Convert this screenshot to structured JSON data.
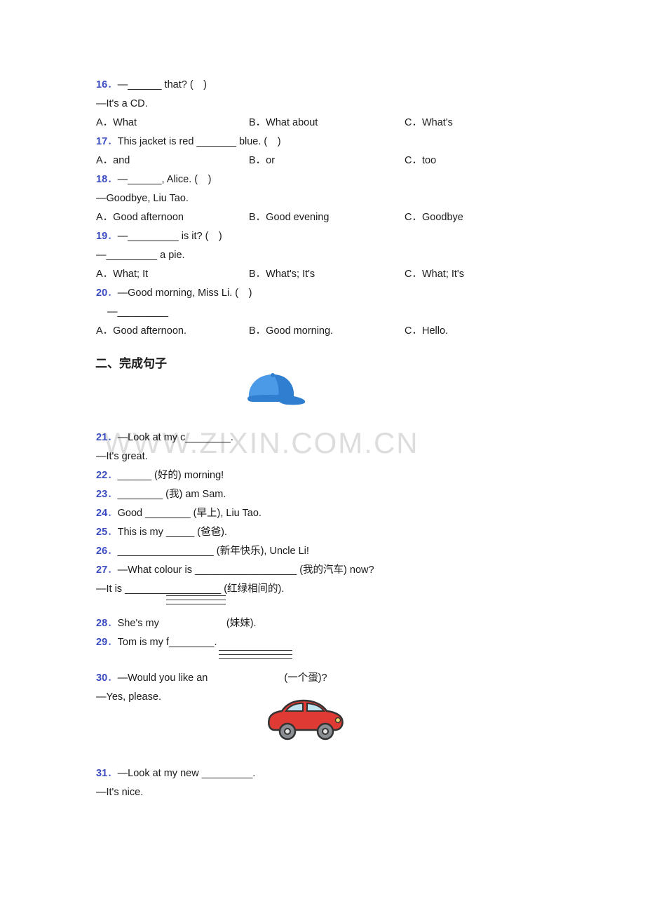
{
  "watermark": "WWW.ZIXIN.COM.CN",
  "questions": [
    {
      "num": "16",
      "stem_pre": "—",
      "stem_blank": "______",
      "stem_post": " that? (　)",
      "answer_line": "—It's a CD.",
      "options": [
        "A．What",
        "B．What about",
        "C．What's"
      ]
    },
    {
      "num": "17",
      "stem_pre": "This jacket is red ",
      "stem_blank": "_______",
      "stem_post": " blue. (　)",
      "answer_line": "",
      "options": [
        "A．and",
        "B．or",
        "C．too"
      ]
    },
    {
      "num": "18",
      "stem_pre": "—",
      "stem_blank": "______",
      "stem_post": ", Alice. (　)",
      "answer_line": "—Goodbye, Liu Tao.",
      "options": [
        "A．Good afternoon",
        "B．Good evening",
        "C．Goodbye"
      ]
    },
    {
      "num": "19",
      "stem_pre": "—",
      "stem_blank": "_________",
      "stem_post": " is it? (　)",
      "answer_line": "—_________ a pie.",
      "options": [
        "A．What; It",
        "B．What's; It's",
        "C．What; It's"
      ]
    },
    {
      "num": "20",
      "stem_pre": "—Good morning, Miss Li. (　)",
      "stem_blank": "",
      "stem_post": "",
      "answer_line": "—_________",
      "options": [
        "A．Good afternoon.",
        "B．Good morning.",
        "C．Hello."
      ]
    }
  ],
  "section2": {
    "title": "二、完成句子",
    "items": [
      {
        "num": "21",
        "line1_pre": "—Look at my c",
        "line1_blank": "________",
        "line1_post": ".",
        "line2": "—It's great."
      },
      {
        "num": "22",
        "line1_pre": "",
        "line1_blank": "______",
        "line1_post": " (好的) morning!",
        "line2": ""
      },
      {
        "num": "23",
        "line1_pre": "",
        "line1_blank": "________",
        "line1_post": " (我) am Sam.",
        "line2": ""
      },
      {
        "num": "24",
        "line1_pre": "Good ",
        "line1_blank": "________",
        "line1_post": " (早上), Liu Tao.",
        "line2": ""
      },
      {
        "num": "25",
        "line1_pre": "This is my ",
        "line1_blank": "_____",
        "line1_post": " (爸爸).",
        "line2": ""
      },
      {
        "num": "26",
        "line1_pre": "",
        "line1_blank": "_________________",
        "line1_post": " (新年快乐), Uncle Li!",
        "line2": ""
      },
      {
        "num": "27",
        "line1_pre": "—What colour is ",
        "line1_blank": "__________________",
        "line1_post": " (我的汽车) now?",
        "line2_pre": "—It is ",
        "line2_blank": "_________________",
        "line2_post": " (红绿相间的).",
        "line2": ""
      },
      {
        "num": "28",
        "line1_pre": "She's my ",
        "line1_blank": "",
        "line1_post": " (妹妹).",
        "line2": "",
        "stacked_blank": true
      },
      {
        "num": "29",
        "line1_pre": "Tom is my f",
        "line1_blank": "________",
        "line1_post": ".",
        "line2": ""
      },
      {
        "num": "30",
        "line1_pre": "—Would you like an ",
        "line1_blank": "",
        "line1_post": "(一个蛋)?",
        "line2": "—Yes, please.",
        "stacked_blank": true
      },
      {
        "num": "31",
        "line1_pre": "—Look at my new ",
        "line1_blank": "_________",
        "line1_post": ".",
        "line2": "—It's nice."
      }
    ]
  },
  "images": {
    "cap": "blue-baseball-cap-image",
    "car": "red-toy-car-image"
  },
  "colors": {
    "question_number": "#3b4cc0",
    "text": "#1a1a1a",
    "watermark": "#d8d8d8",
    "cap_main": "#3b8fe0",
    "cap_dark": "#1d6fc4",
    "car_body": "#e03a34",
    "car_window": "#bfe3ef"
  }
}
